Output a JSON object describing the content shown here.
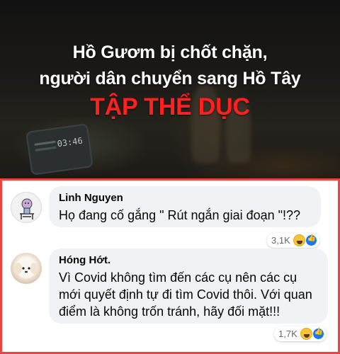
{
  "banner": {
    "line1": "Hồ Gươm bị chốt chặn,",
    "line2": "người dân chuyển sang Hồ Tây",
    "line3": "TẬP THỂ DỤC",
    "phone_time": "03:46",
    "accent_color": "#ff2020"
  },
  "comments": [
    {
      "author": "Linh Nguyen",
      "text": "Họ đang cố gắng \" Rút ngắn giai đoạn \"!??",
      "reaction_count": "3,1K",
      "reactions": [
        "haha-icon",
        "like-icon"
      ]
    },
    {
      "author": "Hóng Hớt.",
      "text": "Vì Covid không tìm đến các cụ nên các cụ mới quyết định tự đi tìm Covid thôi. Với quan điểm là không trốn tránh, hãy đối mặt!!!",
      "reaction_count": "1,7K",
      "reactions": [
        "haha-icon",
        "like-icon"
      ]
    }
  ],
  "colors": {
    "panel_border": "#e84646",
    "bubble_bg": "#f0f2f5",
    "like_blue": "#1877f2"
  }
}
